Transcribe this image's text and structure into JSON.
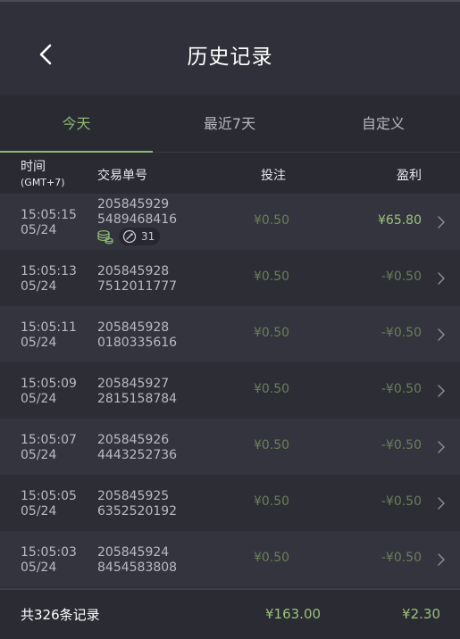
{
  "header": {
    "title": "历史记录",
    "back_icon": "chevron-left-icon"
  },
  "tabs": [
    {
      "label": "今天",
      "active": true
    },
    {
      "label": "最近7天",
      "active": false
    },
    {
      "label": "自定义",
      "active": false
    }
  ],
  "columns": {
    "time": "时间",
    "timezone": "(GMT+7)",
    "order": "交易单号",
    "bet": "投注",
    "profit": "盈利"
  },
  "rows": [
    {
      "time": "15:05:15",
      "date": "05/24",
      "order_line1": "205845929",
      "order_line2": "5489468416",
      "bet": "¥0.50",
      "profit": "¥65.80",
      "badge_count": "31"
    },
    {
      "time": "15:05:13",
      "date": "05/24",
      "order_line1": "205845928",
      "order_line2": "7512011777",
      "bet": "¥0.50",
      "profit": "-¥0.50"
    },
    {
      "time": "15:05:11",
      "date": "05/24",
      "order_line1": "205845928",
      "order_line2": "0180335616",
      "bet": "¥0.50",
      "profit": "-¥0.50"
    },
    {
      "time": "15:05:09",
      "date": "05/24",
      "order_line1": "205845927",
      "order_line2": "2815158784",
      "bet": "¥0.50",
      "profit": "-¥0.50"
    },
    {
      "time": "15:05:07",
      "date": "05/24",
      "order_line1": "205845926",
      "order_line2": "4443252736",
      "bet": "¥0.50",
      "profit": "-¥0.50"
    },
    {
      "time": "15:05:05",
      "date": "05/24",
      "order_line1": "205845925",
      "order_line2": "6352520192",
      "bet": "¥0.50",
      "profit": "-¥0.50"
    },
    {
      "time": "15:05:03",
      "date": "05/24",
      "order_line1": "205845924",
      "order_line2": "8454583808",
      "bet": "¥0.50",
      "profit": "-¥0.50"
    }
  ],
  "footer": {
    "count_label": "共326条记录",
    "total_bet": "¥163.00",
    "total_profit": "¥2.30"
  },
  "colors": {
    "accent": "#8db872",
    "profit_positive": "#9bc27a",
    "muted_value": "#6a7f5a"
  }
}
